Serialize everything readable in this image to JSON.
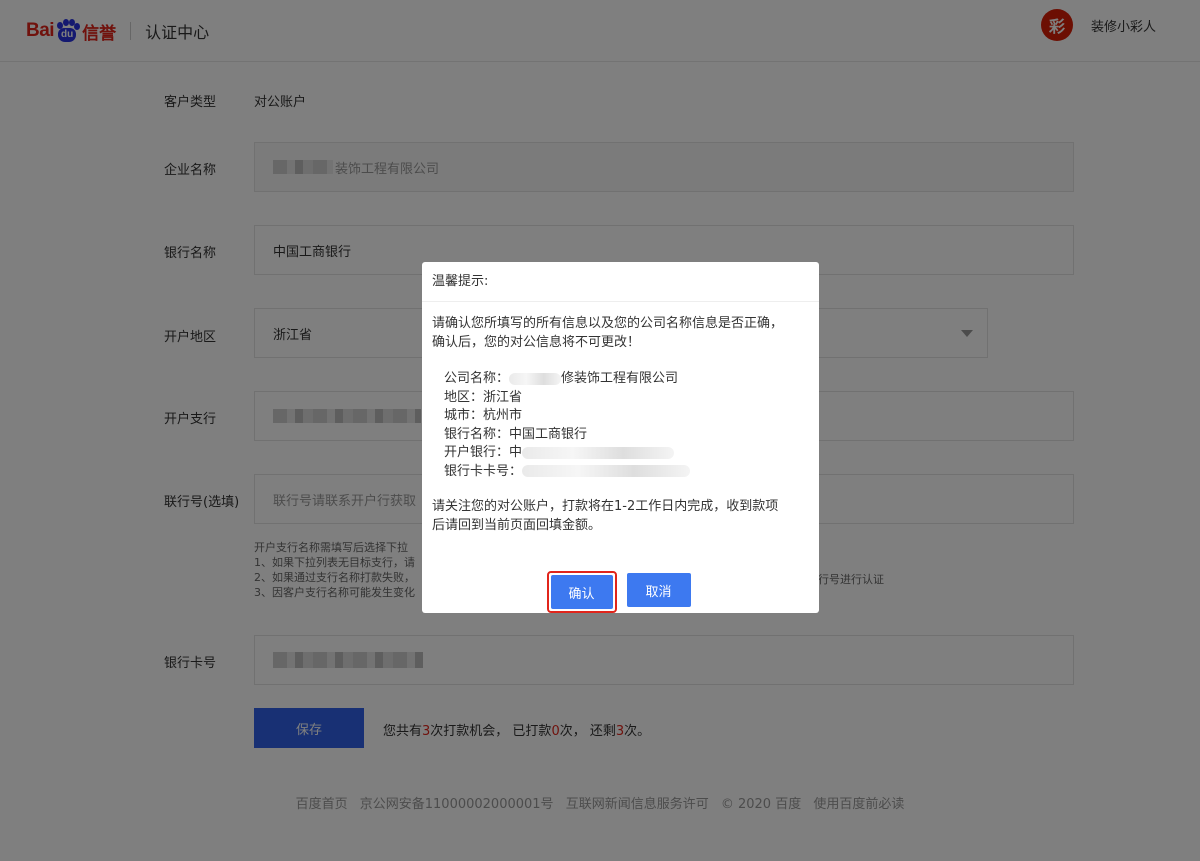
{
  "header": {
    "logo_bai": "Bai",
    "logo_du": "du",
    "logo_xinyu": "信誉",
    "title": "认证中心",
    "avatar_char": "彩",
    "username": "装修小彩人"
  },
  "form": {
    "customer_type_label": "客户类型",
    "customer_type_value": "对公账户",
    "company_label": "企业名称",
    "company_value": "装饰工程有限公司",
    "bank_label": "银行名称",
    "bank_value": "中国工商银行",
    "region_label": "开户地区",
    "region_value": "浙江省",
    "branch_label": "开户支行",
    "branch_value": "",
    "bankno_label": "联行号(选填)",
    "bankno_placeholder": "联行号请联系开户行获取",
    "hint_lines": [
      "开户支行名称需填写后选择下拉",
      "1、如果下拉列表无目标支行，请",
      "2、如果通过支行名称打款失败，",
      "3、因客户支行名称可能发生变化"
    ],
    "hint_tail": "行号进行认证",
    "card_label": "银行卡号",
    "save_label": "保存",
    "chance_pre": "您共有",
    "chance_total": "3",
    "chance_mid1": "次打款机会，  已打款",
    "chance_used": "0",
    "chance_mid2": "次，  还剩",
    "chance_left": "3",
    "chance_end": "次。"
  },
  "footer": {
    "links": [
      "百度首页",
      "京公网安备11000002000001号",
      "互联网新闻信息服务许可",
      "© 2020 百度",
      "使用百度前必读"
    ]
  },
  "modal": {
    "title": "温馨提示:",
    "line1": "请确认您所填写的所有信息以及您的公司名称信息是否正确，",
    "line2": "确认后，您的对公信息将不可更改！",
    "company": "公司名称：",
    "company_tail": "修装饰工程有限公司",
    "region": "地区：浙江省",
    "city": "城市：杭州市",
    "bank": "银行名称：中国工商银行",
    "branch": "开户银行：中",
    "card": "银行卡卡号：",
    "notice1": "请关注您的对公账户，打款将在1-2工作日内完成，收到款项",
    "notice2": "后请回到当前页面回填金额。",
    "confirm": "确认",
    "cancel": "取消"
  }
}
